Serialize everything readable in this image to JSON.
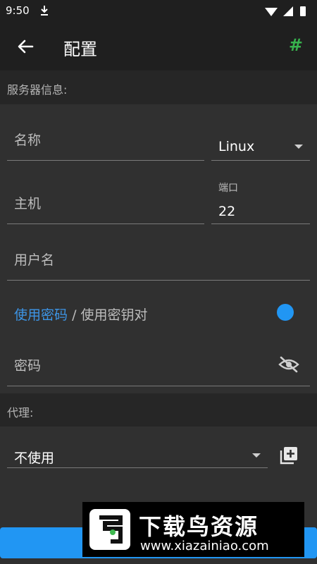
{
  "statusbar": {
    "time": "9:50"
  },
  "appbar": {
    "title": "配置",
    "hash": "#"
  },
  "sections": {
    "server": "服务器信息:",
    "proxy": "代理:"
  },
  "server": {
    "name_label": "名称",
    "os_value": "Linux",
    "host_label": "主机",
    "port_label": "端口",
    "port_value": "22",
    "username_label": "用户名",
    "auth_active": "使用密码",
    "auth_sep": "/",
    "auth_inactive": "使用密钥对",
    "password_label": "密码"
  },
  "proxy": {
    "value": "不使用"
  },
  "watermark": {
    "title": "下载鸟资源",
    "url": "www.xiazainiao.com"
  }
}
